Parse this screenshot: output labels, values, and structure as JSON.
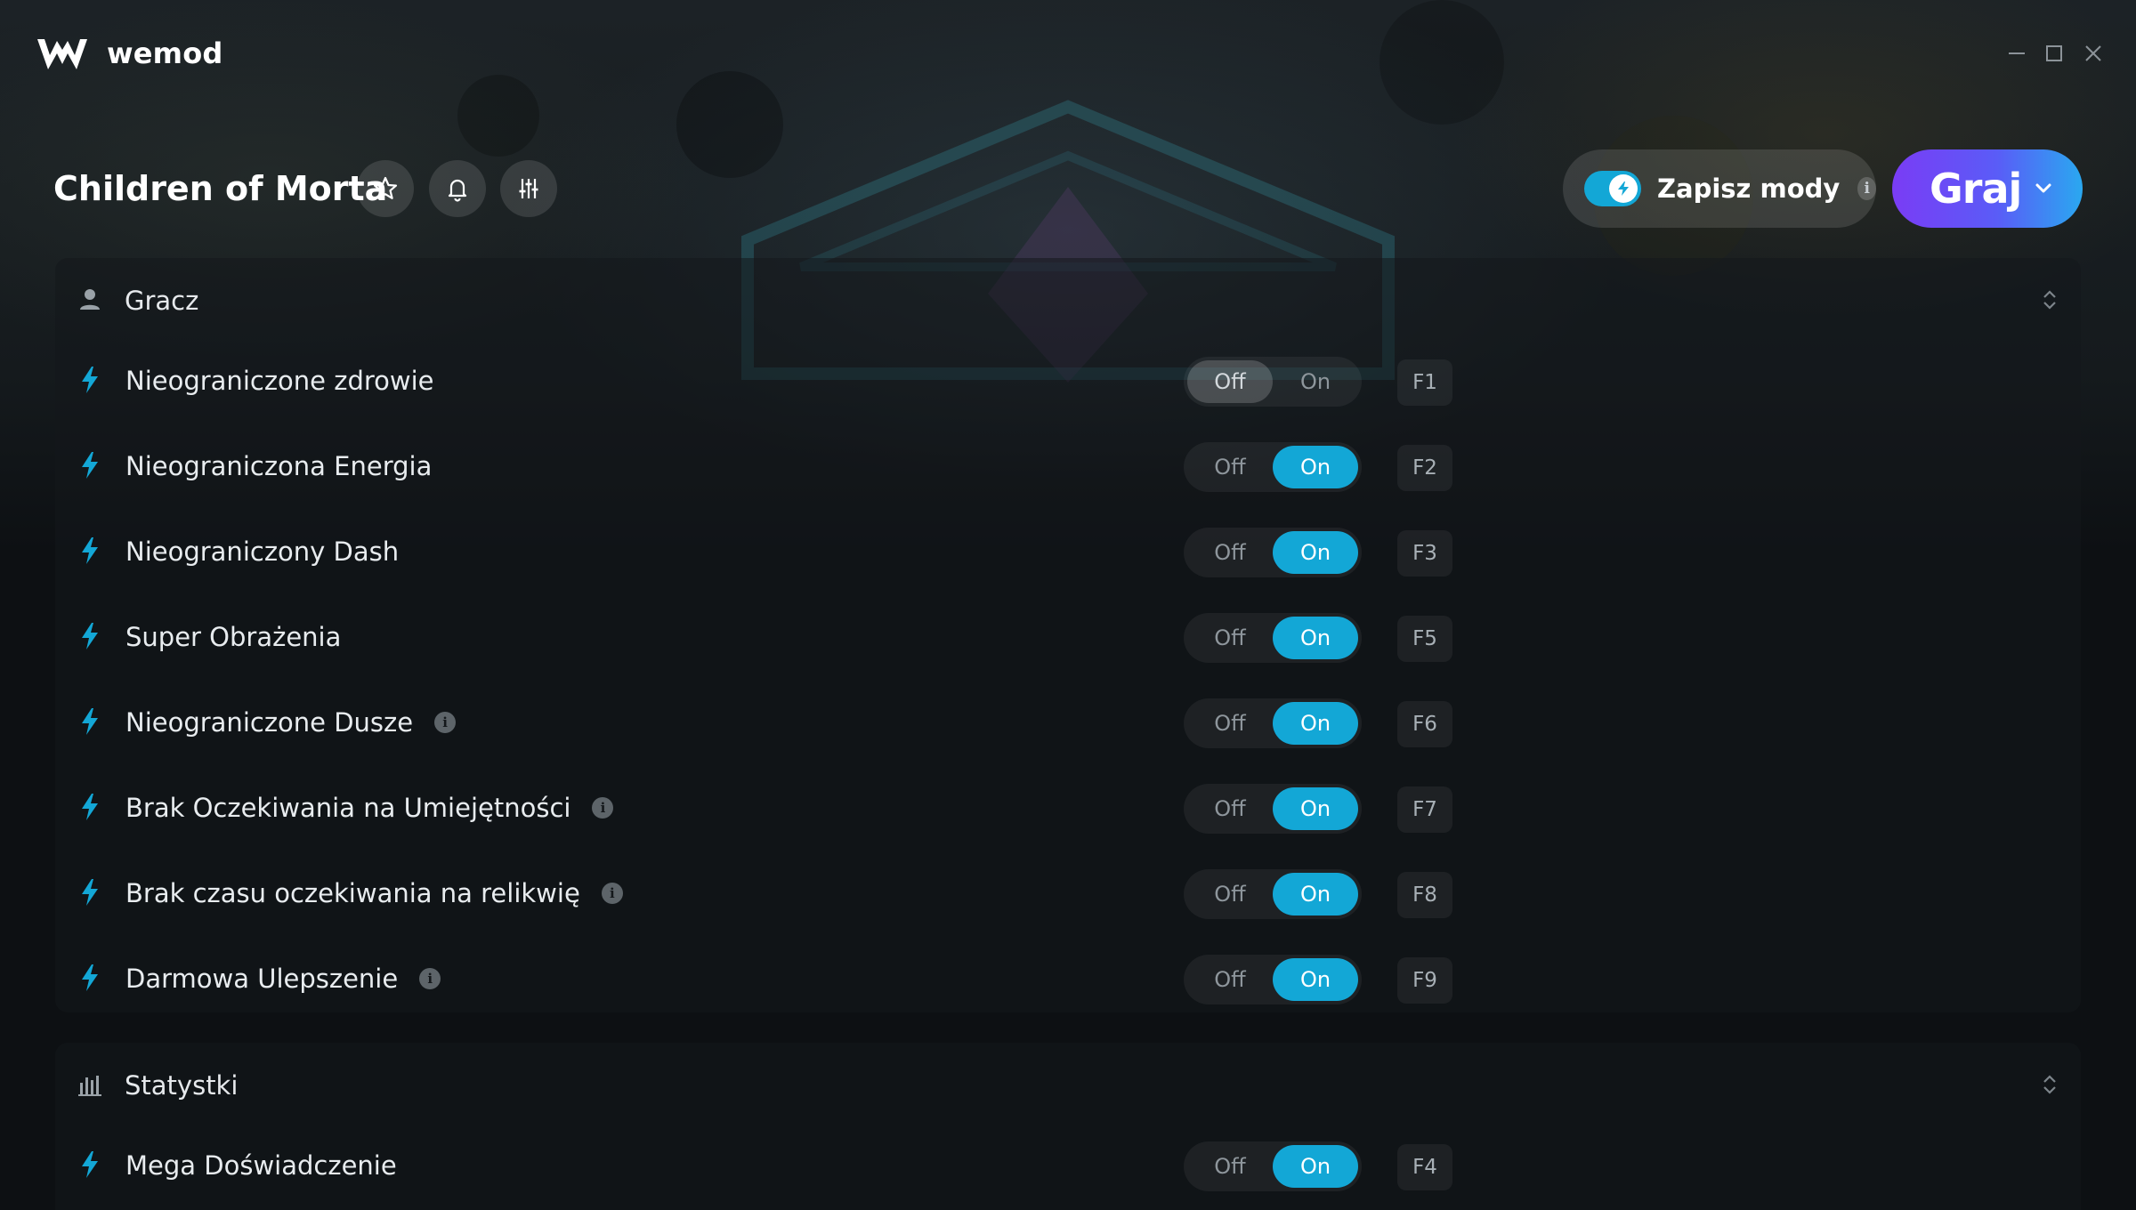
{
  "app": {
    "brand": "wemod"
  },
  "header": {
    "game_title": "Children of Morta",
    "save_mods_label": "Zapisz mody",
    "save_mods_on": true,
    "info_glyph": "i",
    "play_label": "Graj"
  },
  "colors": {
    "accent": "#13a7d6",
    "play_gradient_start": "#7a3cf5",
    "play_gradient_end": "#2aa8f0"
  },
  "sections": [
    {
      "title": "Gracz",
      "icon": "person-icon",
      "mods": [
        {
          "name": "Nieograniczone zdrowie",
          "off": "Off",
          "on": "On",
          "state": "off",
          "hotkey": "F1",
          "info": false
        },
        {
          "name": "Nieograniczona Energia",
          "off": "Off",
          "on": "On",
          "state": "on",
          "hotkey": "F2",
          "info": false
        },
        {
          "name": "Nieograniczony Dash",
          "off": "Off",
          "on": "On",
          "state": "on",
          "hotkey": "F3",
          "info": false
        },
        {
          "name": "Super Obrażenia",
          "off": "Off",
          "on": "On",
          "state": "on",
          "hotkey": "F5",
          "info": false
        },
        {
          "name": "Nieograniczone Dusze",
          "off": "Off",
          "on": "On",
          "state": "on",
          "hotkey": "F6",
          "info": true
        },
        {
          "name": "Brak Oczekiwania na Umiejętności",
          "off": "Off",
          "on": "On",
          "state": "on",
          "hotkey": "F7",
          "info": true
        },
        {
          "name": "Brak czasu oczekiwania na relikwię",
          "off": "Off",
          "on": "On",
          "state": "on",
          "hotkey": "F8",
          "info": true
        },
        {
          "name": "Darmowa Ulepszenie",
          "off": "Off",
          "on": "On",
          "state": "on",
          "hotkey": "F9",
          "info": true
        }
      ]
    },
    {
      "title": "Statystki",
      "icon": "bar-chart-icon",
      "mods": [
        {
          "name": "Mega Doświadczenie",
          "off": "Off",
          "on": "On",
          "state": "on",
          "hotkey": "F4",
          "info": false
        }
      ]
    }
  ]
}
